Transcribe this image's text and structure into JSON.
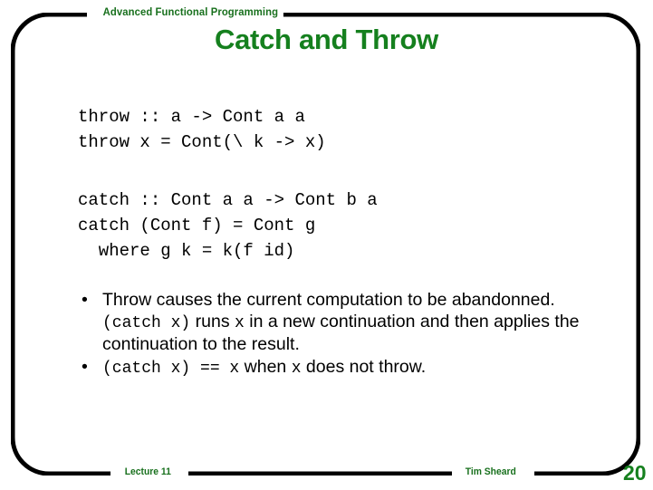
{
  "slide": {
    "kicker": "Advanced Functional Programming",
    "title": "Catch and Throw",
    "page_number": "20",
    "accent_color": "#15801e",
    "frame_color": "#000000",
    "background": "#ffffff"
  },
  "code": {
    "throw_block": "throw :: a -> Cont a a\nthrow x = Cont(\\ k -> x)",
    "catch_block": "catch :: Cont a a -> Cont b a\ncatch (Cont f) = Cont g\n  where g k = k(f id)"
  },
  "bullets": [
    {
      "marker": "•",
      "parts": [
        {
          "text": "Throw causes the current computation to be abandonned. ",
          "style": "sans"
        },
        {
          "text": "(catch x)",
          "style": "mono"
        },
        {
          "text": " runs ",
          "style": "sans"
        },
        {
          "text": "x",
          "style": "mono"
        },
        {
          "text": " in a new continuation and then applies the continuation to the result.",
          "style": "sans"
        }
      ]
    },
    {
      "marker": "•",
      "parts": [
        {
          "text": "(catch x) == x",
          "style": "mono"
        },
        {
          "text": " when ",
          "style": "sans"
        },
        {
          "text": "x",
          "style": "mono"
        },
        {
          "text": " does not throw.",
          "style": "sans"
        }
      ]
    }
  ],
  "footer": {
    "lecture": "Lecture 11",
    "author": "Tim Sheard"
  }
}
